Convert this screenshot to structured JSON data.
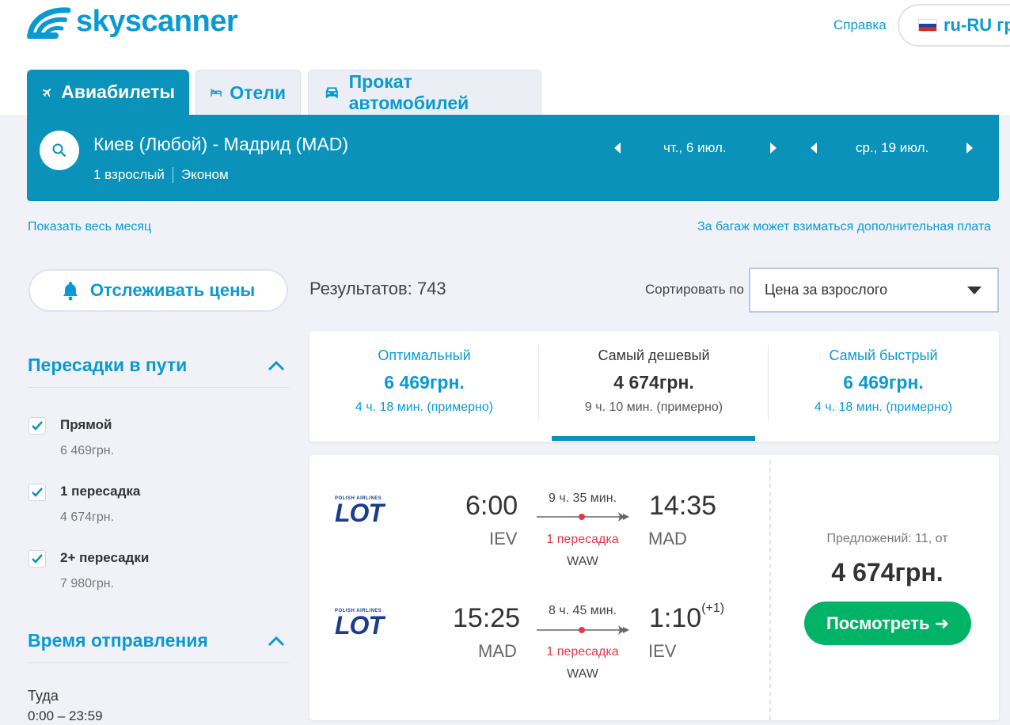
{
  "header": {
    "logo_text": "skyscanner",
    "help_link": "Справка",
    "locale": "ru-RU гр"
  },
  "tabs": [
    {
      "label": "Авиабилеты",
      "icon": "plane-icon",
      "active": true
    },
    {
      "label": "Отели",
      "icon": "bed-icon",
      "active": false
    },
    {
      "label": "Прокат автомобилей",
      "icon": "car-icon",
      "active": false
    }
  ],
  "search": {
    "route": "Киев (Любой) - Мадрид (MAD)",
    "passengers": "1 взрослый",
    "cabin": "Эконом",
    "depart_date": "чт., 6 июл.",
    "return_date": "ср., 19 июл."
  },
  "links": {
    "show_month": "Показать весь месяц",
    "baggage_note": "За багаж может взиматься дополнительная плата"
  },
  "track_prices": "Отслеживать цены",
  "results": {
    "count_text": "Результатов: 743",
    "sort_label": "Сортировать по",
    "sort_value": "Цена за взрослого"
  },
  "filters": {
    "stops_title": "Пересадки в пути",
    "stops": [
      {
        "label": "Прямой",
        "price": "6 469грн.",
        "checked": true
      },
      {
        "label": "1 пересадка",
        "price": "4 674грн.",
        "checked": true
      },
      {
        "label": "2+ пересадки",
        "price": "7 980грн.",
        "checked": true
      }
    ],
    "departure_title": "Время отправления",
    "outbound_label": "Туда",
    "outbound_range": "0:00 – 23:59"
  },
  "summary": [
    {
      "title": "Оптимальный",
      "price": "6 469грн.",
      "duration": "4 ч. 18 мин. (примерно)",
      "selected": false
    },
    {
      "title": "Самый дешевый",
      "price": "4 674грн.",
      "duration": "9 ч. 10 мин. (примерно)",
      "selected": true
    },
    {
      "title": "Самый быстрый",
      "price": "6 469грн.",
      "duration": "4 ч. 18 мин. (примерно)",
      "selected": false
    }
  ],
  "result": {
    "airline_small": "POLISH AIRLINES",
    "airline_logo": "LOT",
    "legs": [
      {
        "dep_time": "6:00",
        "dep_airport": "IEV",
        "duration": "9 ч. 35 мин.",
        "stops": "1 пересадка",
        "via": "WAW",
        "arr_time": "14:35",
        "arr_day": "",
        "arr_airport": "MAD"
      },
      {
        "dep_time": "15:25",
        "dep_airport": "MAD",
        "duration": "8 ч. 45 мин.",
        "stops": "1 пересадка",
        "via": "WAW",
        "arr_time": "1:10",
        "arr_day": "(+1)",
        "arr_airport": "IEV"
      }
    ],
    "offers": "Предложений: 11, от",
    "price": "4 674грн.",
    "view_button": "Посмотреть ➜"
  },
  "colors": {
    "brand": "#0a9ad3",
    "searchbar": "#0a92bb",
    "cta": "#00b366",
    "stops_red": "#e5364a"
  }
}
